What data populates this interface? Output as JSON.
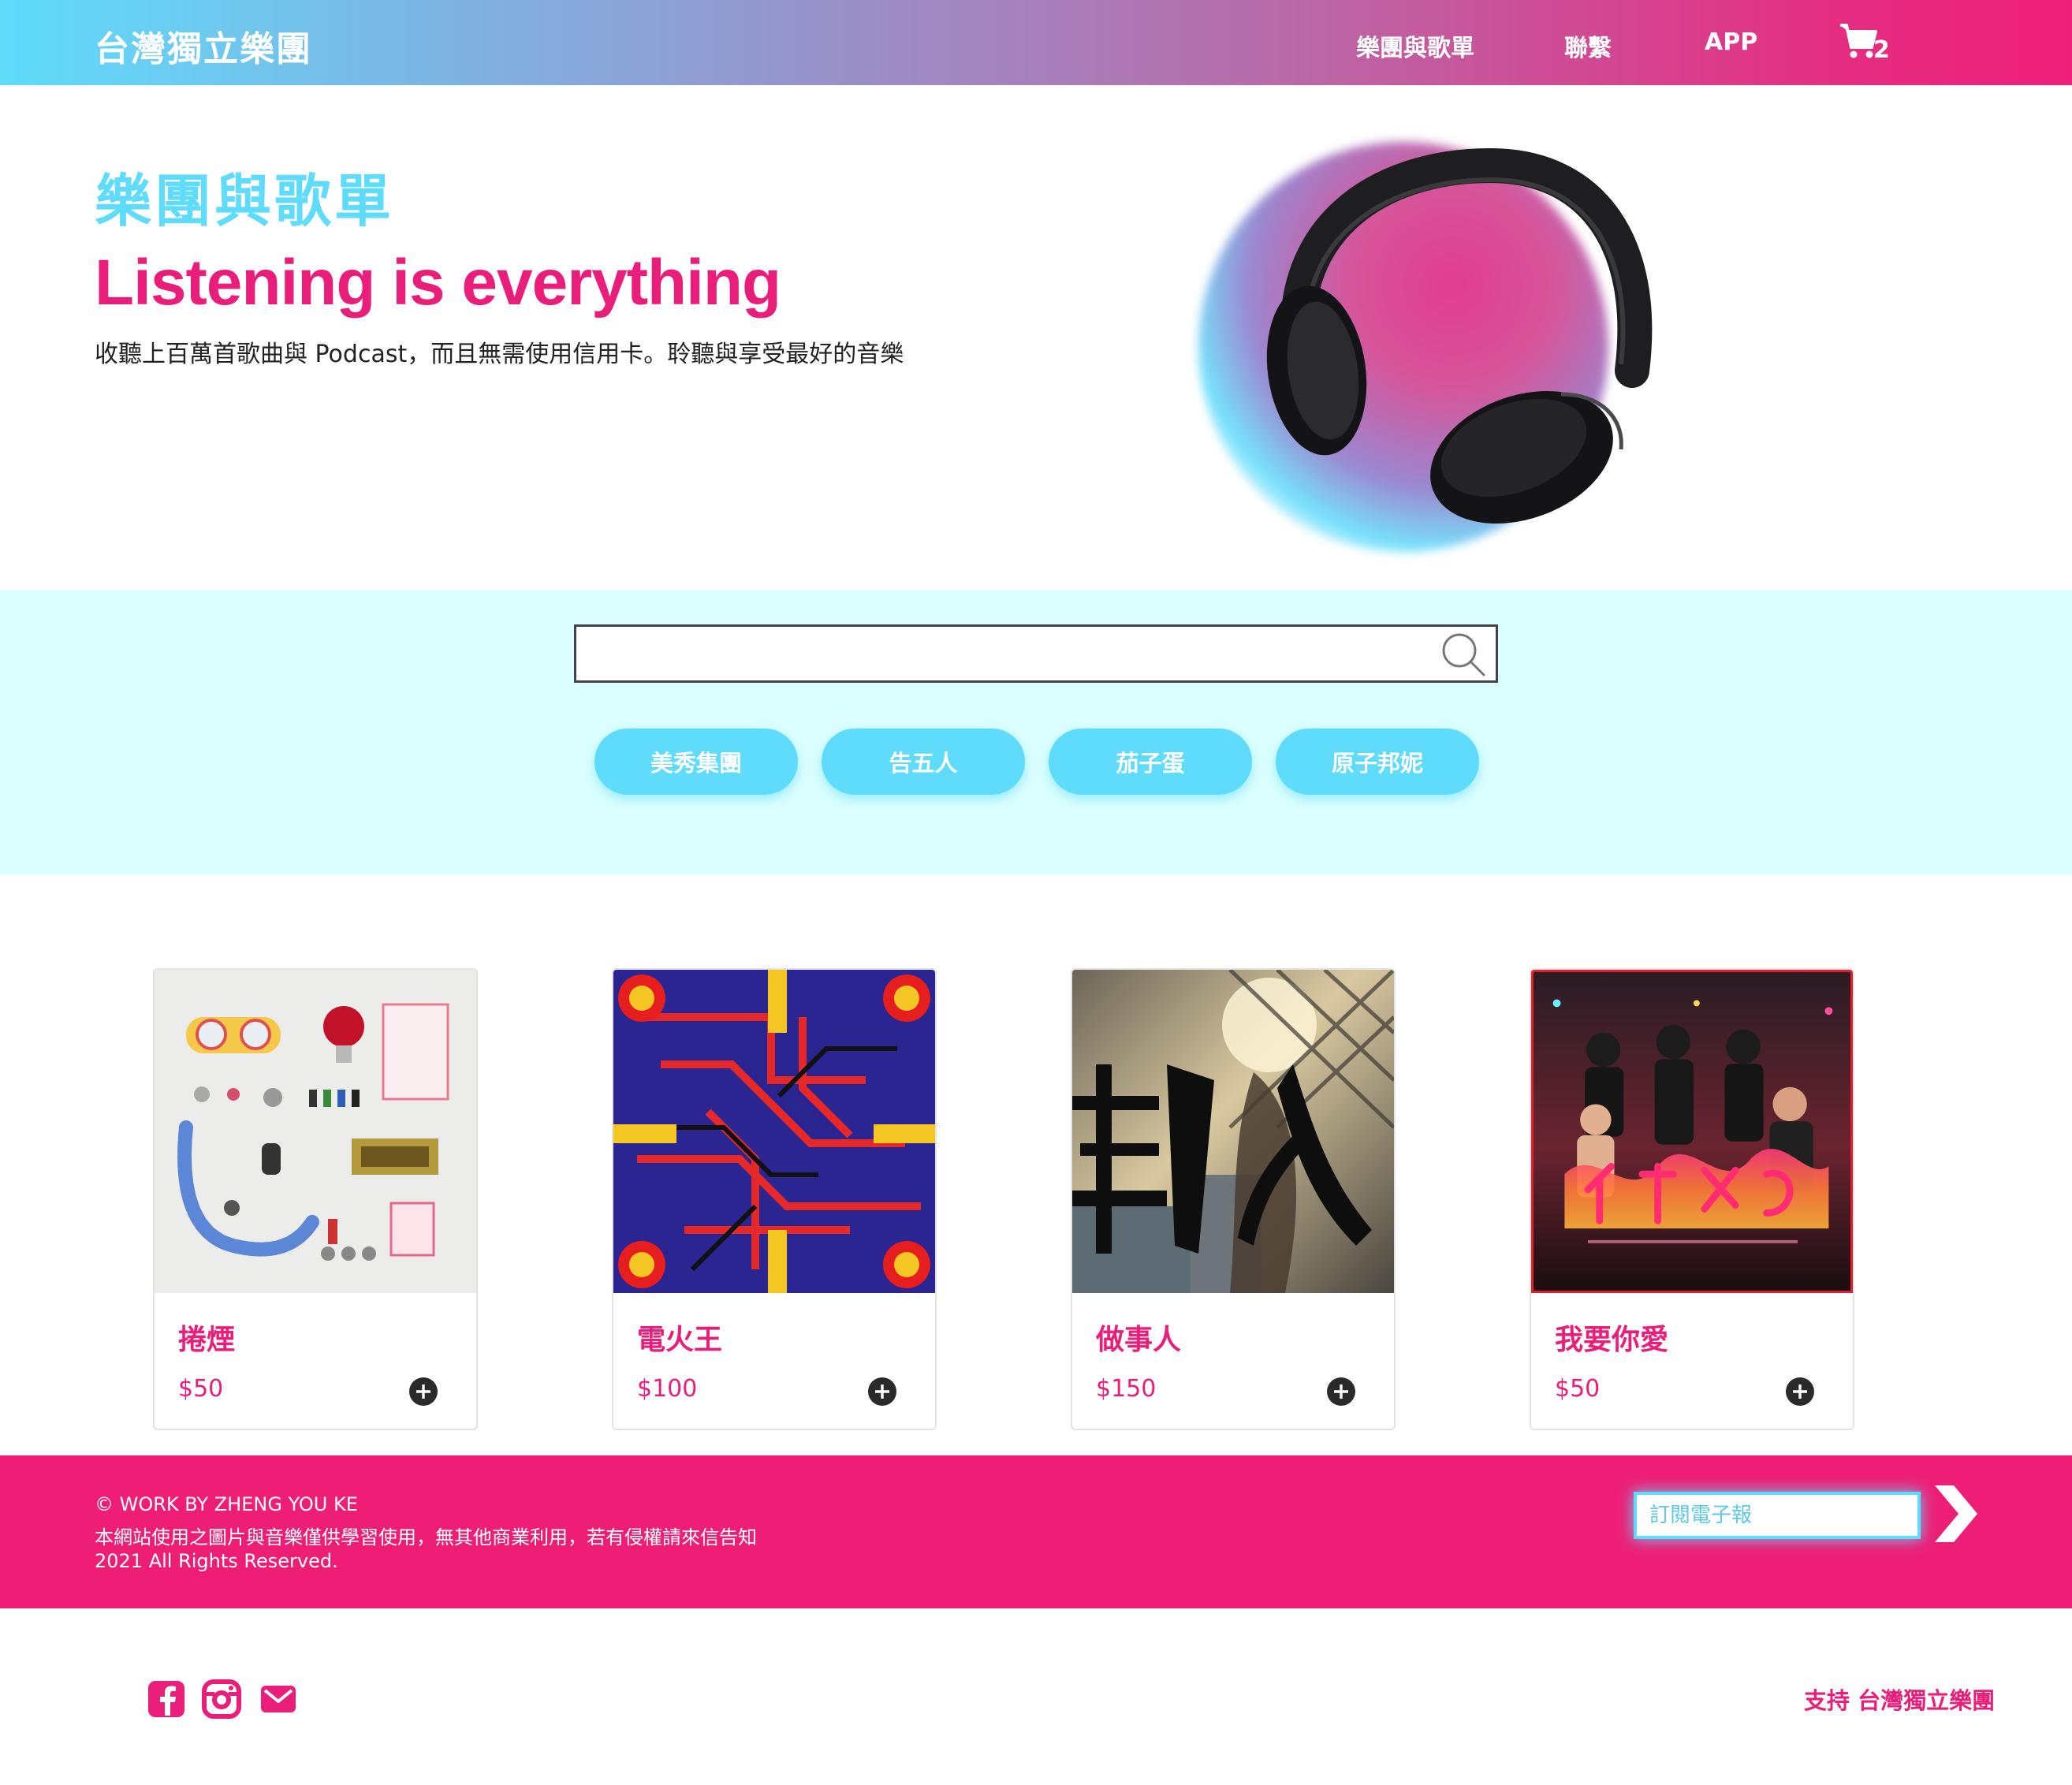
{
  "header": {
    "brand": "台灣獨立樂團",
    "nav": [
      "樂團與歌單",
      "聯繫",
      "APP"
    ],
    "cart_count": "2"
  },
  "hero": {
    "title": "樂團與歌單",
    "subtitle": "Listening is everything",
    "description": "收聽上百萬首歌曲與 Podcast，而且無需使用信用卡。聆聽與享受最好的音樂"
  },
  "search": {
    "placeholder": "",
    "tags": [
      "美秀集團",
      "告五人",
      "茄子蛋",
      "原子邦妮"
    ]
  },
  "products": [
    {
      "title": "捲煙",
      "price": "$50"
    },
    {
      "title": "電火王",
      "price": "$100"
    },
    {
      "title": "做事人",
      "price": "$150"
    },
    {
      "title": "我要你愛",
      "price": "$50"
    }
  ],
  "footer": {
    "credit": "© WORK BY ZHENG YOU KE",
    "notice": "本網站使用之圖片與音樂僅供學習使用，無其他商業利用，若有侵權請來信告知",
    "rights": "2021 All Rights Reserved.",
    "newsletter_placeholder": "訂閱電子報",
    "support": "支持 台灣獨立樂團"
  },
  "icons": [
    "cart-icon",
    "search-icon",
    "plus-circle-icon",
    "chevron-right-icon",
    "facebook-icon",
    "instagram-icon",
    "mail-icon"
  ],
  "colors": {
    "brand_pink": "#e91e7a",
    "brand_cyan": "#5fdcfb",
    "band_bg": "#dcffff",
    "footer_bg": "#ee1e76"
  }
}
